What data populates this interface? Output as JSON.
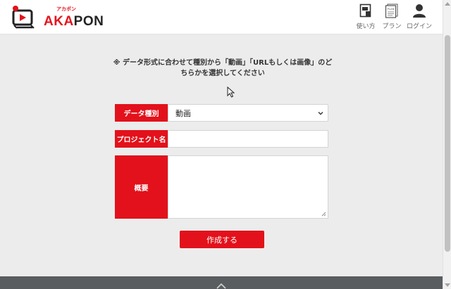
{
  "brand": {
    "name_part1": "AKA",
    "name_part2": "PON",
    "kana": "アカポン",
    "accent_color": "#e3111b"
  },
  "nav": {
    "usage_label": "使い方",
    "plan_label": "プラン",
    "login_label": "ログイン",
    "plan_icon_text": "PLAN"
  },
  "notice": "※ データ形式に合わせて種別から「動画」「URLもしくは画像」のどちらかを選択してください",
  "form": {
    "type_label": "データ種別",
    "type_value": "動画",
    "project_name_label": "プロジェクト名",
    "project_name_value": "",
    "summary_label": "概要",
    "summary_value": "",
    "submit_label": "作成する"
  },
  "icons": {
    "usage": "usage-book-icon",
    "plan": "plan-document-icon",
    "login": "user-icon",
    "select": "chevron-down-icon",
    "footer": "chevron-up-icon"
  }
}
